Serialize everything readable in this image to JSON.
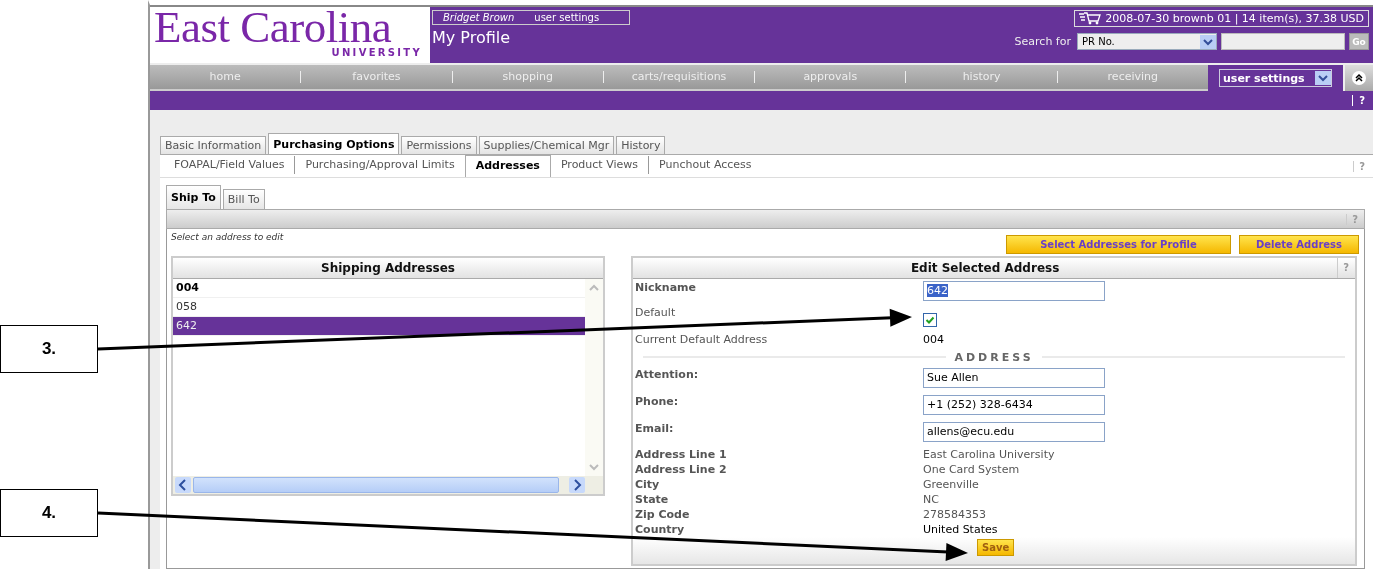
{
  "callouts": [
    {
      "label": "3."
    },
    {
      "label": "4."
    }
  ],
  "header": {
    "logo_name": "East Carolina",
    "logo_sub": "UNIVERSITY",
    "user": "Bridget Brown",
    "user_link": "user settings",
    "page_title": "My Profile",
    "cart": "2008-07-30 brownb 01 | 14 item(s), 37.38 USD",
    "search_label": "Search for",
    "search_select": "PR No.",
    "go": "Go"
  },
  "nav": {
    "items": [
      "home",
      "favorites",
      "shopping",
      "carts/requisitions",
      "approvals",
      "history",
      "receiving"
    ],
    "dropdown": "user settings",
    "help": "?"
  },
  "tabs": [
    {
      "label": "Basic Information",
      "selected": false
    },
    {
      "label": "Purchasing Options",
      "selected": true
    },
    {
      "label": "Permissions",
      "selected": false
    },
    {
      "label": "Supplies/Chemical Mgr",
      "selected": false
    },
    {
      "label": "History",
      "selected": false
    }
  ],
  "subtabs": [
    {
      "label": "FOAPAL/Field Values",
      "selected": false
    },
    {
      "label": "Purchasing/Approval Limits",
      "selected": false
    },
    {
      "label": "Addresses",
      "selected": true
    },
    {
      "label": "Product Views",
      "selected": false
    },
    {
      "label": "Punchout Access",
      "selected": false
    }
  ],
  "subtabs_help": "?",
  "address_tabs": [
    {
      "label": "Ship To",
      "selected": true
    },
    {
      "label": "Bill To",
      "selected": false
    }
  ],
  "bar_help": "?",
  "hint": "Select an address to edit",
  "actions": [
    "Select Addresses for Profile",
    "Delete Address"
  ],
  "list": {
    "title": "Shipping Addresses",
    "items": [
      {
        "label": "004",
        "is_default": true,
        "selected": false
      },
      {
        "label": "058",
        "is_default": false,
        "selected": false
      },
      {
        "label": "642",
        "is_default": false,
        "selected": true
      }
    ]
  },
  "editor": {
    "title": "Edit Selected Address",
    "help": "?",
    "fields": [
      {
        "kind": "input",
        "label": "Nickname",
        "value": "642",
        "text_selected": true
      },
      {
        "kind": "checkbox",
        "label": "Default",
        "checked": true
      },
      {
        "kind": "current",
        "label": "Current Default Address",
        "value": "004"
      },
      {
        "kind": "section",
        "label": "ADDRESS"
      },
      {
        "kind": "input",
        "label": "Attention:",
        "value": "Sue Allen",
        "text_selected": false
      },
      {
        "kind": "input",
        "label": "Phone:",
        "value": "+1 (252) 328-6434",
        "text_selected": false
      },
      {
        "kind": "input",
        "label": "Email:",
        "value": "allens@ecu.edu",
        "text_selected": false
      },
      {
        "kind": "readonly",
        "label": "Address Line 1",
        "value": "East Carolina University"
      },
      {
        "kind": "readonly",
        "label": "Address Line 2",
        "value": "One Card System"
      },
      {
        "kind": "readonly",
        "label": "City",
        "value": "Greenville"
      },
      {
        "kind": "readonly",
        "label": "State",
        "value": "NC"
      },
      {
        "kind": "readonly",
        "label": "Zip Code",
        "value": "278584353"
      },
      {
        "kind": "fixed",
        "label": "Country",
        "value": "United States"
      }
    ],
    "save": "Save"
  }
}
